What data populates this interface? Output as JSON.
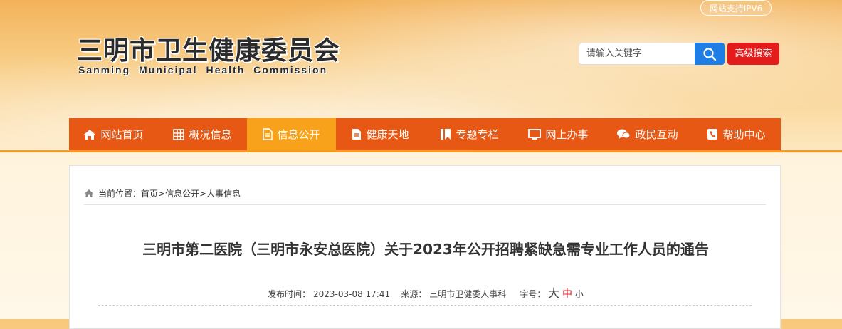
{
  "header": {
    "ipv6_badge": "网站支持IPV6",
    "logo_cn": "三明市卫生健康委员会",
    "logo_en": "Sanming Municipal Health Commission",
    "search_placeholder": "请输入关键字",
    "advanced_search": "高级搜索"
  },
  "nav": {
    "items": [
      {
        "label": "网站首页",
        "icon": "home-icon"
      },
      {
        "label": "概况信息",
        "icon": "grid-icon"
      },
      {
        "label": "信息公开",
        "icon": "document-icon",
        "active": true
      },
      {
        "label": "健康天地",
        "icon": "file-text-icon"
      },
      {
        "label": "专题专栏",
        "icon": "bookmark-icon"
      },
      {
        "label": "网上办事",
        "icon": "monitor-icon"
      },
      {
        "label": "政民互动",
        "icon": "chat-icon"
      },
      {
        "label": "帮助中心",
        "icon": "phone-book-icon"
      }
    ]
  },
  "breadcrumb": {
    "prefix": "当前位置：",
    "home": "首页",
    "sep1": ">",
    "section": "信息公开",
    "sep2": ">",
    "current": "人事信息"
  },
  "article": {
    "title": "三明市第二医院（三明市永安总医院）关于2023年公开招聘紧缺急需专业工作人员的通告",
    "publish_label": "发布时间：",
    "publish_time": "2023-03-08 17:41",
    "source_label": "来源：",
    "source": "三明市卫健委人事科",
    "fontsize_label": "字号：",
    "fontsize_large": "大",
    "fontsize_medium": "中",
    "fontsize_small": "小"
  },
  "colors": {
    "nav_bg": "#e75814",
    "nav_active": "#f8a11a",
    "search_button": "#1f7ee6",
    "advanced_button": "#e31b1b"
  }
}
